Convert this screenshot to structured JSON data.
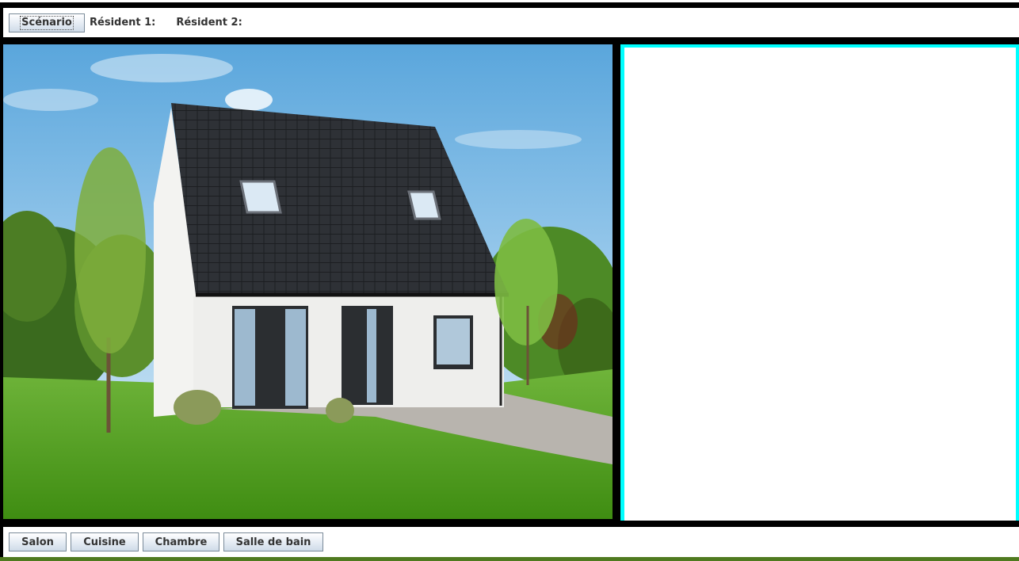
{
  "top_bar": {
    "scenario_button": "Scénario",
    "resident1_label": "Résident 1:",
    "resident2_label": "Résident 2:"
  },
  "rooms": [
    {
      "label": "Salon"
    },
    {
      "label": "Cuisine"
    },
    {
      "label": "Chambre"
    },
    {
      "label": "Salle de bain"
    }
  ],
  "colors": {
    "side_panel_border": "#00ffff",
    "bottom_strip": "#4f7a1f",
    "frame": "#000000"
  },
  "icons": [
    "house-illustration"
  ]
}
